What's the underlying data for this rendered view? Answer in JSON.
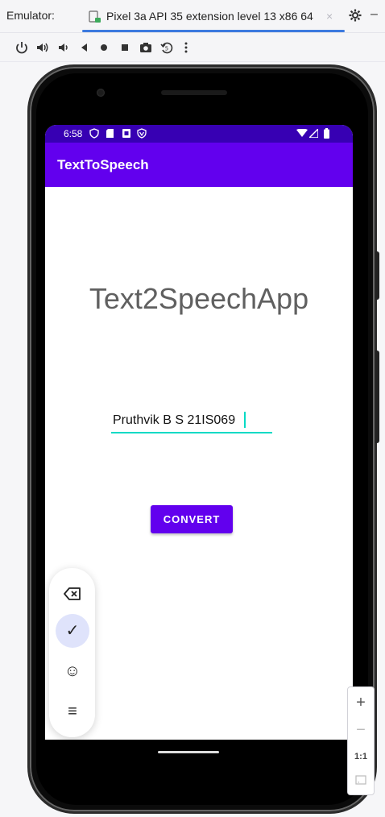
{
  "window": {
    "label": "Emulator:",
    "tab_title": "Pixel 3a API 35 extension level 13 x86 64",
    "tab_close": "×",
    "minimize": "–"
  },
  "toolbar": {
    "icons": [
      "power-icon",
      "volume-up-icon",
      "volume-down-icon",
      "back-icon",
      "home-icon",
      "overview-icon",
      "screenshot-icon",
      "rotate-icon",
      "more-icon"
    ]
  },
  "status_bar": {
    "time": "6:58"
  },
  "app": {
    "title": "TextToSpeech",
    "heading": "Text2SpeechApp",
    "input_value": "Pruthvik B S 21IS069",
    "button_label": "CONVERT"
  },
  "keyboard_bar": {
    "items": [
      "backspace-icon",
      "checkmark-icon",
      "emoji-icon",
      "menu-icon"
    ],
    "checkmark": "✓",
    "emoji": "☺",
    "menu": "≡"
  },
  "zoom_panel": {
    "plus": "+",
    "minus": "−",
    "ratio": "1:1"
  },
  "colors": {
    "primary": "#6200ee",
    "primary_dark": "#3700b3",
    "accent": "#03dac5",
    "tab_underline": "#3c7adf"
  }
}
